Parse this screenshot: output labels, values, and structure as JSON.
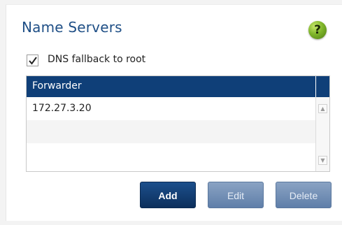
{
  "panel": {
    "title": "Name Servers",
    "help_icon": "help-question-icon",
    "help_glyph": "?"
  },
  "dns_fallback": {
    "label": "DNS fallback to root",
    "checked": true
  },
  "forwarder_table": {
    "header": "Forwarder",
    "rows": [
      "172.27.3.20",
      "",
      ""
    ],
    "scroll_up_glyph": "▲",
    "scroll_down_glyph": "▼"
  },
  "buttons": {
    "add": "Add",
    "edit": "Edit",
    "delete": "Delete"
  },
  "colors": {
    "title": "#1f4f86",
    "header_bg": "#0f3f78",
    "primary_button": "#0c2f5c",
    "disabled_button": "#7a96bb",
    "help_icon": "#7fb52a"
  }
}
